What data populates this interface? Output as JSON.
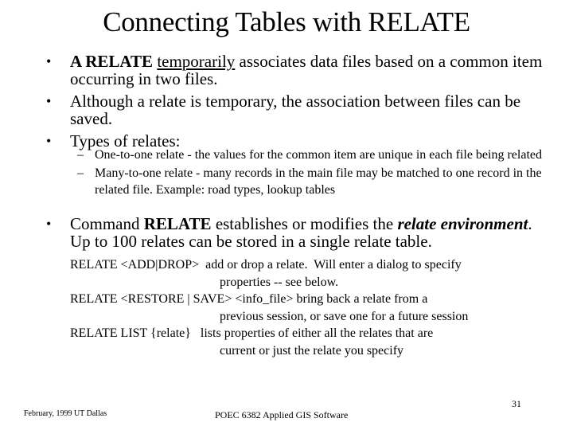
{
  "slide": {
    "title": "Connecting Tables with RELATE",
    "bullets": [
      {
        "bold": "A RELATE",
        "underlined": "temporarily",
        "text": " associates data files based on a common item occurring in two files."
      },
      {
        "text": "Although a relate is temporary, the association between files can be saved."
      },
      {
        "text": "Types of relates:"
      }
    ],
    "sub_bullets": [
      {
        "text": "One-to-one relate - the values for the common item are unique in each file being related"
      },
      {
        "text": "Many-to-one relate - many records in the main file may be matched to one record in the related file.  Example: road types, lookup tables"
      }
    ],
    "command_bullet": {
      "prefix": "Command ",
      "bold": "RELATE",
      "middle": " establishes or modifies the ",
      "italic_bold": "relate environment",
      "suffix": ".  Up to 100 relates can be stored in a single relate table."
    },
    "commands": [
      {
        "cmd": "RELATE <ADD|DROP>  add or drop a relate.  Will enter a dialog to specify",
        "cont": "properties -- see below."
      },
      {
        "cmd": "RELATE <RESTORE | SAVE> <info_file> bring back a relate from a",
        "cont": "previous session, or save one for a future session"
      },
      {
        "cmd": "RELATE LIST {relate}   lists properties of either all the relates that are",
        "cont": "current or just the relate you specify"
      }
    ],
    "footer": {
      "left": "February, 1999 UT Dallas",
      "center": "POEC 6382 Applied GIS Software",
      "page_number": "31"
    }
  }
}
